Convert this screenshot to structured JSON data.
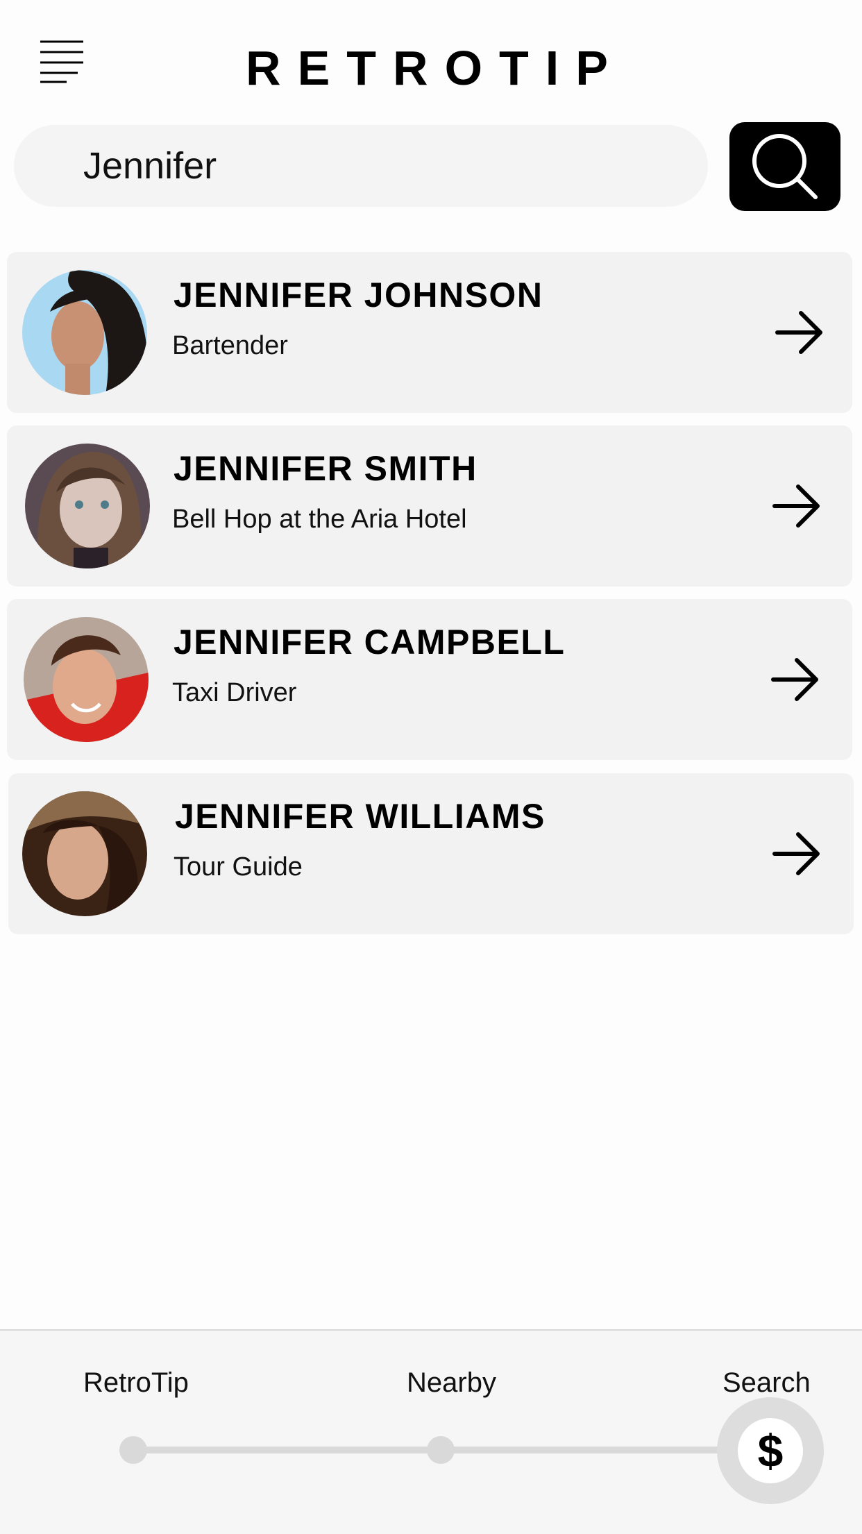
{
  "header": {
    "title": "RETROTIP",
    "menu_icon": "hamburger-menu-icon"
  },
  "search": {
    "value": "Jennifer",
    "button_icon": "search-icon"
  },
  "results": [
    {
      "name": "JENNIFER JOHNSON",
      "role": "Bartender",
      "avatar": "avatar-photo",
      "action_icon": "arrow-right-icon"
    },
    {
      "name": "JENNIFER SMITH",
      "role": "Bell Hop at the Aria Hotel",
      "avatar": "avatar-photo",
      "action_icon": "arrow-right-icon"
    },
    {
      "name": "JENNIFER CAMPBELL",
      "role": "Taxi Driver",
      "avatar": "avatar-photo",
      "action_icon": "arrow-right-icon"
    },
    {
      "name": "JENNIFER WILLIAMS",
      "role": "Tour Guide",
      "avatar": "avatar-photo",
      "action_icon": "arrow-right-icon"
    }
  ],
  "bottom_nav": {
    "items": [
      {
        "label": "RetroTip"
      },
      {
        "label": "Nearby"
      },
      {
        "label": "Search"
      }
    ],
    "selected": "Search",
    "knob_symbol": "$"
  },
  "colors": {
    "background": "#fdfdfd",
    "card": "#f2f2f2",
    "search_field": "#f4f4f4",
    "accent": "#000000",
    "track": "#d9d9d9"
  }
}
